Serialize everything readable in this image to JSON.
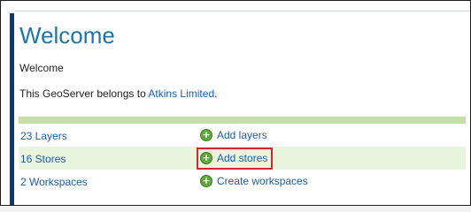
{
  "page": {
    "title": "Welcome",
    "welcome_text": "Welcome",
    "belongs_prefix": "This GeoServer belongs to ",
    "organization": "Atkins Limited",
    "belongs_suffix": "."
  },
  "summary_rows": [
    {
      "stat": "23 Layers",
      "action": "Add layers"
    },
    {
      "stat": "16 Stores",
      "action": "Add stores"
    },
    {
      "stat": "2 Workspaces",
      "action": "Create workspaces"
    }
  ],
  "colors": {
    "title": "#1b75a8",
    "link": "#1b5ea8",
    "accent_bar": "#0a3c7a",
    "table_header": "#c4e0a8",
    "alt_row": "#e9f4dd",
    "highlight": "#d0262c"
  },
  "icons": {
    "action": "plus-circle-icon"
  }
}
